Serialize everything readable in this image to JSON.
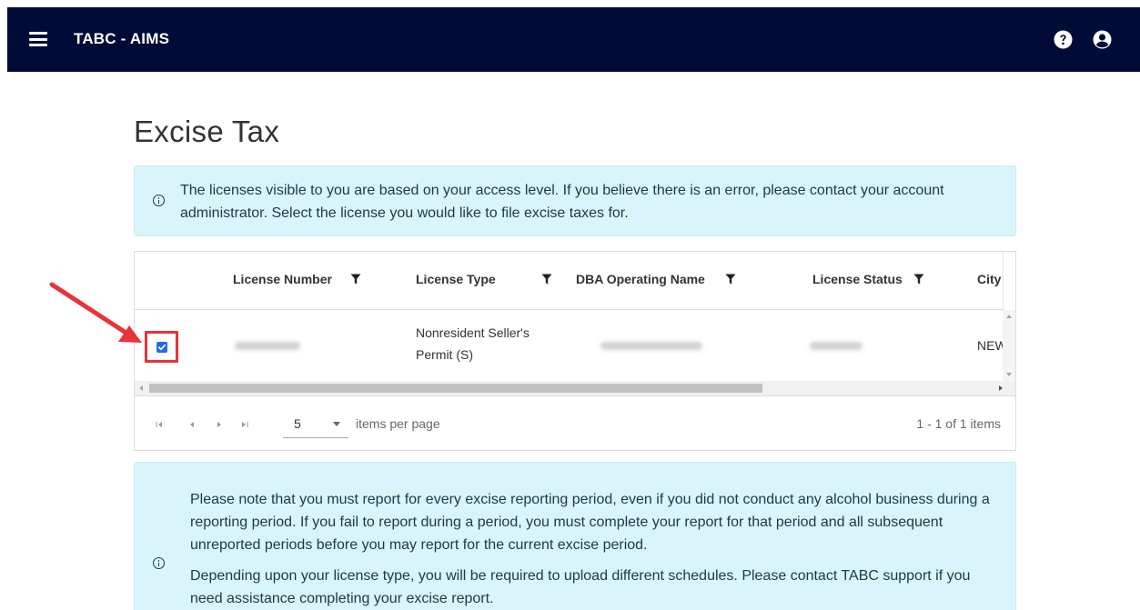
{
  "header": {
    "app_title": "TABC - AIMS",
    "icons": [
      "hamburger-menu-icon",
      "help-icon",
      "user-account-icon"
    ],
    "background_color": "#000b38"
  },
  "page": {
    "title": "Excise Tax"
  },
  "alerts": {
    "access_notice": "The licenses visible to you are based on your access level. If you believe there is an error, please contact your account administrator. Select the license you would like to file excise taxes for.",
    "reporting_notice_1": "Please note that you must report for every excise reporting period, even if you did not conduct any alcohol business during a reporting period. If you fail to report during a period, you must complete your report for that period and all subsequent unreported periods before you may report for the current excise period.",
    "reporting_notice_2": "Depending upon your license type, you will be required to upload different schedules. Please contact TABC support if you need assistance completing your excise report.",
    "background_color": "#d9f4fb"
  },
  "grid": {
    "columns": [
      {
        "label": "License Number"
      },
      {
        "label": "License Type"
      },
      {
        "label": "DBA Operating Name"
      },
      {
        "label": "License Status"
      },
      {
        "label": "City"
      }
    ],
    "rows": [
      {
        "selected": true,
        "license_number": "[redacted]",
        "license_type": "Nonresident Seller's Permit (S)",
        "dba_operating_name": "[redacted]",
        "license_status": "[redacted]",
        "city": "NEW"
      }
    ],
    "pager": {
      "page_size": "5",
      "items_per_page_label": "items per page",
      "info": "1 - 1 of 1 items"
    },
    "checkbox_color": "#1f6fe0"
  },
  "annotation": {
    "highlight_color": "#e8333a"
  }
}
